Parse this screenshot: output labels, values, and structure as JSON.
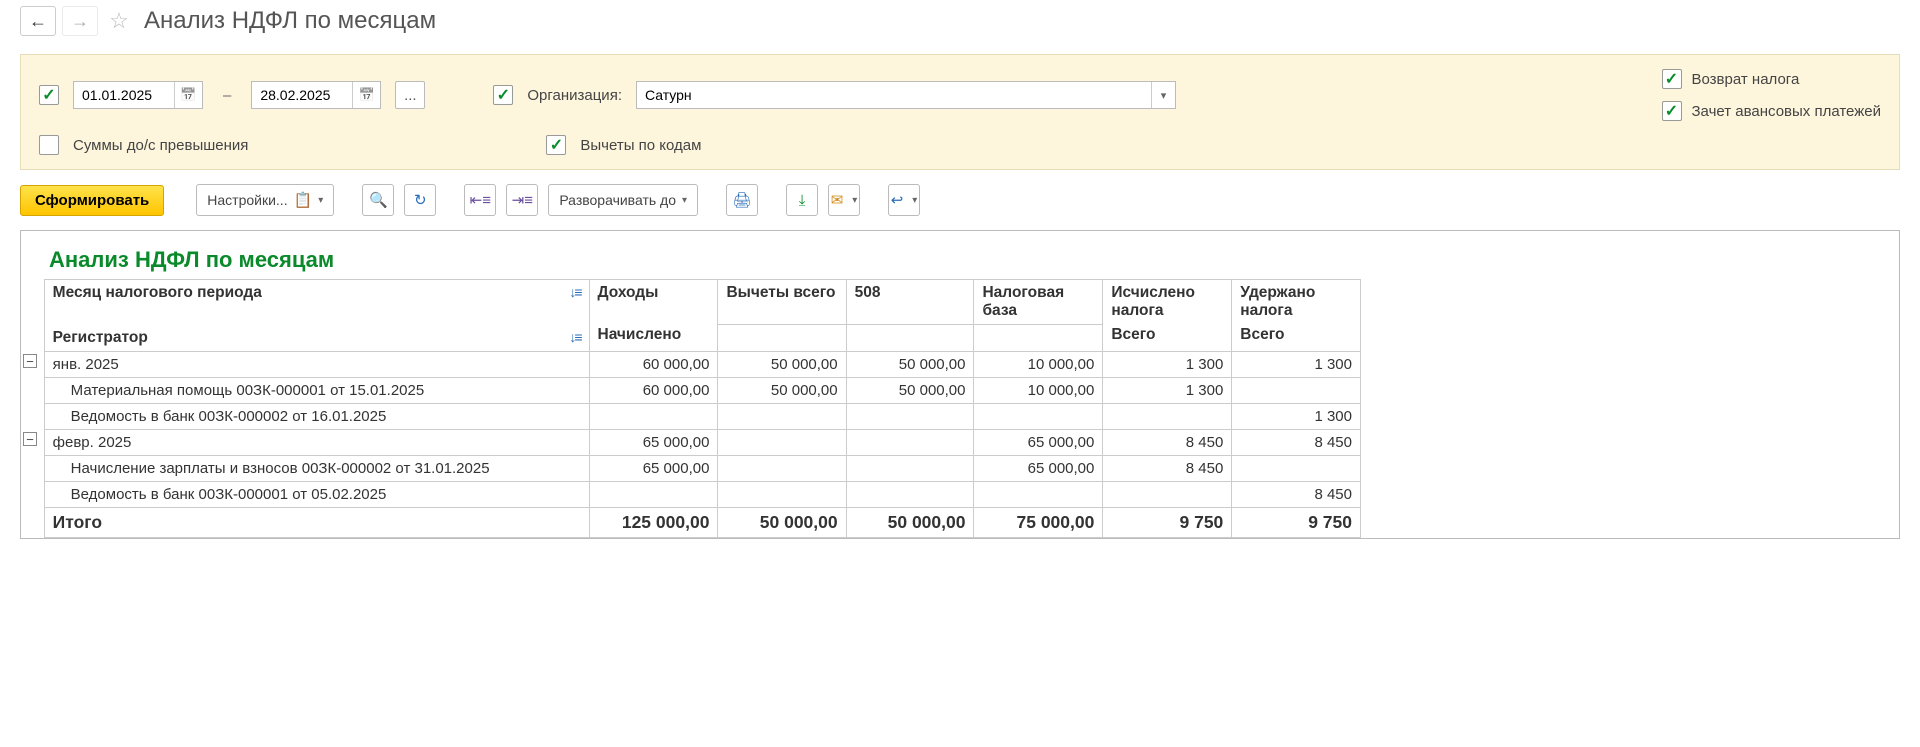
{
  "title": "Анализ НДФЛ по месяцам",
  "filters": {
    "period_check": true,
    "date_from": "01.01.2025",
    "date_to": "28.02.2025",
    "dots": "...",
    "org_check": true,
    "org_label": "Организация:",
    "org_value": "Сатурн",
    "codes_check": true,
    "codes_label": "Вычеты по кодам",
    "excess_check": false,
    "excess_label": "Суммы до/с превышения",
    "refund_check": true,
    "refund_label": "Возврат налога",
    "advance_check": true,
    "advance_label": "Зачет авансовых платежей"
  },
  "toolbar": {
    "form": "Сформировать",
    "settings": "Настройки...",
    "expand_to": "Разворачивать до"
  },
  "report": {
    "title": "Анализ НДФЛ по месяцам",
    "hdr": {
      "month": "Месяц налогового периода",
      "reg": "Регистратор",
      "income": "Доходы",
      "income_sub": "Начислено",
      "ded_total": "Вычеты всего",
      "c508": "508",
      "base": "Налоговая база",
      "calc": "Исчислено налога",
      "calc_sub": "Всего",
      "withheld": "Удержано налога",
      "withheld_sub": "Всего"
    },
    "rows": [
      {
        "type": "group",
        "label": "янв. 2025",
        "income": "60 000,00",
        "ded": "50 000,00",
        "c508": "50 000,00",
        "base": "10 000,00",
        "calc": "1 300",
        "withheld": "1 300"
      },
      {
        "type": "detail",
        "label": "Материальная помощь 00ЗК-000001 от 15.01.2025",
        "income": "60 000,00",
        "ded": "50 000,00",
        "c508": "50 000,00",
        "base": "10 000,00",
        "calc": "1 300",
        "withheld": ""
      },
      {
        "type": "detail",
        "label": "Ведомость в банк 00ЗК-000002 от 16.01.2025",
        "income": "",
        "ded": "",
        "c508": "",
        "base": "",
        "calc": "",
        "withheld": "1 300"
      },
      {
        "type": "group",
        "label": "февр. 2025",
        "income": "65 000,00",
        "ded": "",
        "c508": "",
        "base": "65 000,00",
        "calc": "8 450",
        "withheld": "8 450"
      },
      {
        "type": "detail",
        "label": "Начисление зарплаты и взносов 00ЗК-000002 от 31.01.2025",
        "income": "65 000,00",
        "ded": "",
        "c508": "",
        "base": "65 000,00",
        "calc": "8 450",
        "withheld": ""
      },
      {
        "type": "detail",
        "label": "Ведомость в банк 00ЗК-000001 от 05.02.2025",
        "income": "",
        "ded": "",
        "c508": "",
        "base": "",
        "calc": "",
        "withheld": "8 450"
      }
    ],
    "total": {
      "label": "Итого",
      "income": "125 000,00",
      "ded": "50 000,00",
      "c508": "50 000,00",
      "base": "75 000,00",
      "calc": "9 750",
      "withheld": "9 750"
    }
  }
}
